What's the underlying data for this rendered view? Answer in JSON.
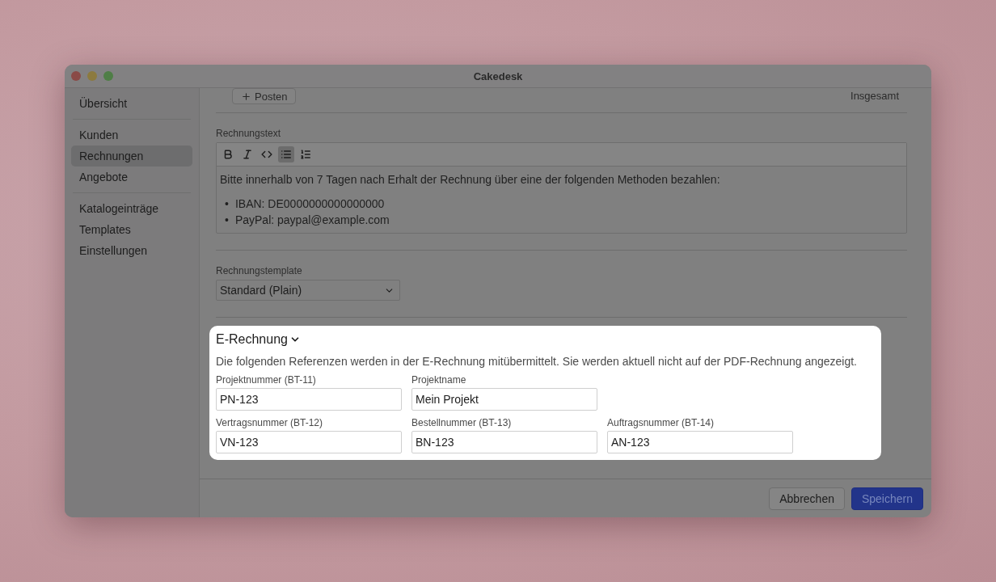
{
  "window": {
    "title": "Cakedesk"
  },
  "sidebar": {
    "sections": [
      {
        "items": [
          {
            "label": "Übersicht",
            "selected": false
          }
        ]
      },
      {
        "items": [
          {
            "label": "Kunden",
            "selected": false
          },
          {
            "label": "Rechnungen",
            "selected": true
          },
          {
            "label": "Angebote",
            "selected": false
          }
        ]
      },
      {
        "items": [
          {
            "label": "Katalogeinträge",
            "selected": false
          },
          {
            "label": "Templates",
            "selected": false
          },
          {
            "label": "Einstellungen",
            "selected": false
          }
        ]
      }
    ]
  },
  "items_bar": {
    "add_button": "Posten",
    "total_label": "Insgesamt"
  },
  "invoice_text": {
    "label": "Rechnungstext",
    "toolbar": [
      {
        "kind": "bold",
        "active": false
      },
      {
        "kind": "italic",
        "active": false
      },
      {
        "kind": "code",
        "active": false
      },
      {
        "kind": "bullet_list",
        "active": true
      },
      {
        "kind": "numbered_list",
        "active": false
      }
    ],
    "paragraph": "Bitte innerhalb von 7 Tagen nach Erhalt der Rechnung über eine der folgenden Methoden bezahlen:",
    "bullets": [
      {
        "marker": "•",
        "text": "IBAN: DE0000000000000000"
      },
      {
        "marker": "•",
        "text": "PayPal: paypal@example.com"
      }
    ]
  },
  "template": {
    "label": "Rechnungstemplate",
    "value": "Standard (Plain)"
  },
  "e_invoice": {
    "title": "E-Rechnung",
    "expanded": true,
    "description": "Die folgenden Referenzen werden in der E-Rechnung mitübermittelt. Sie werden aktuell nicht auf der PDF-Rechnung angezeigt.",
    "rows": [
      [
        {
          "label": "Projektnummer (BT-11)",
          "value": "PN-123"
        },
        {
          "label": "Projektname",
          "value": "Mein Projekt"
        }
      ],
      [
        {
          "label": "Vertragsnummer (BT-12)",
          "value": "VN-123"
        },
        {
          "label": "Bestellnummer (BT-13)",
          "value": "BN-123"
        },
        {
          "label": "Auftragsnummer (BT-14)",
          "value": "AN-123"
        }
      ]
    ]
  },
  "footer": {
    "buttons": [
      {
        "label": "Abbrechen",
        "kind": "secondary"
      },
      {
        "label": "Speichern",
        "kind": "primary"
      }
    ]
  }
}
